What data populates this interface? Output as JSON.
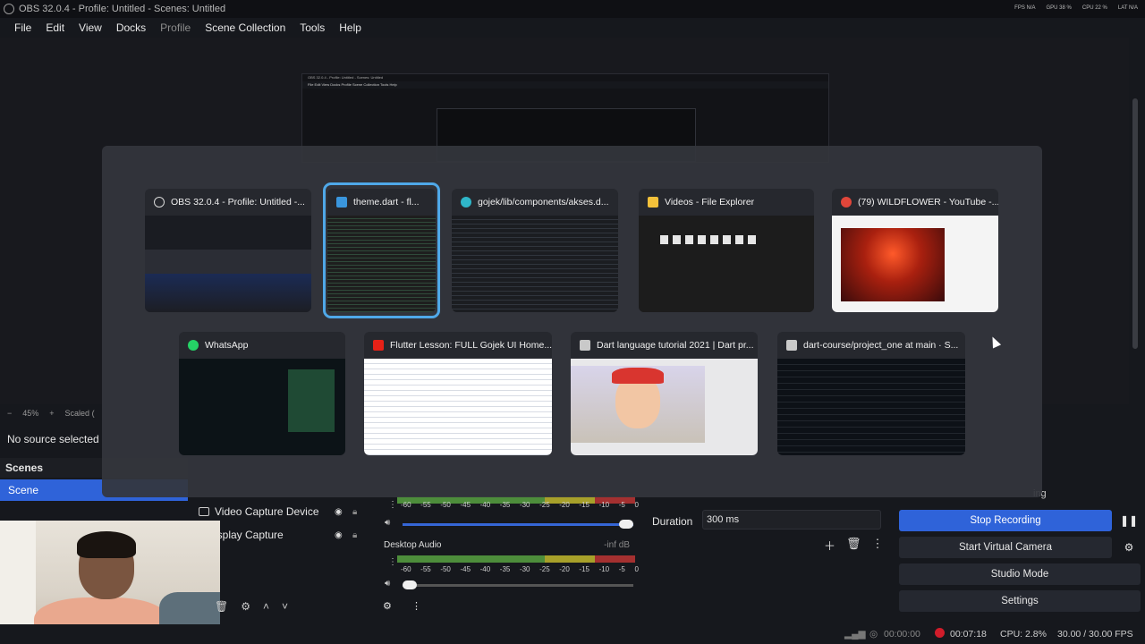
{
  "window": {
    "title": "OBS 32.0.4 - Profile: Untitled - Scenes: Untitled",
    "stats": [
      "FPS N/A",
      "GPU 38 %",
      "CPU 22 %",
      "LAT N/A"
    ]
  },
  "menu": [
    "File",
    "Edit",
    "View",
    "Docks",
    "Profile",
    "Scene Collection",
    "Tools",
    "Help"
  ],
  "preview": {
    "mini_title": "OBS 32.0.4 - Profile: Untitled - Scenes: Untitled",
    "mini_menu": "File  Edit  View  Docks  Profile  Scene Collection  Tools  Help",
    "zoom": "45%",
    "scaled_label": "Scaled ("
  },
  "no_source": "No source selected",
  "scenes": {
    "header": "Scenes",
    "items": [
      "Scene"
    ]
  },
  "sources": [
    {
      "name": "Video Capture Device"
    },
    {
      "name": "isplay Capture"
    }
  ],
  "mixer": {
    "ticks": [
      "-60",
      "-55",
      "-50",
      "-45",
      "-40",
      "-35",
      "-30",
      "-25",
      "-20",
      "-15",
      "-10",
      "-5",
      "0"
    ],
    "tracks": [
      {
        "name": "",
        "level": "",
        "volume": 1.0
      },
      {
        "name": "Desktop Audio",
        "level": "-inf dB",
        "volume": 0.0
      }
    ]
  },
  "transition": {
    "duration_label": "Duration",
    "duration_value": "300 ms"
  },
  "controls": {
    "partial": "ing",
    "stop_recording": "Stop Recording",
    "virtual_camera": "Start Virtual Camera",
    "studio_mode": "Studio Mode",
    "settings": "Settings"
  },
  "status": {
    "stream_time": "00:00:00",
    "rec_time": "00:07:18",
    "cpu": "CPU: 2.8%",
    "fps": "30.00 / 30.00 FPS"
  },
  "switcher": {
    "row1": [
      {
        "title": "OBS 32.0.4 - Profile: Untitled -...",
        "icon": "obs-icon",
        "color": "#d8d8d8"
      },
      {
        "title": "theme.dart - fl...",
        "icon": "vscode-icon",
        "color": "#3a96dd"
      },
      {
        "title": "gojek/lib/components/akses.d...",
        "icon": "edge-icon",
        "color": "#2fb6c9"
      },
      {
        "title": "Videos - File Explorer",
        "icon": "folder-icon",
        "color": "#f3c13a"
      },
      {
        "title": "(79) WILDFLOWER - YouTube -...",
        "icon": "chrome-icon",
        "color": "#e0463a"
      }
    ],
    "row2": [
      {
        "title": "WhatsApp",
        "icon": "whatsapp-icon",
        "color": "#25d366"
      },
      {
        "title": "Flutter Lesson: FULL Gojek UI Home...",
        "icon": "youtube-icon",
        "color": "#e62117"
      },
      {
        "title": "Dart language tutorial 2021 | Dart pr...",
        "icon": "window-icon",
        "color": "#c9c9c9"
      },
      {
        "title": "dart-course/project_one at main · S...",
        "icon": "window-icon",
        "color": "#c9c9c9"
      }
    ],
    "selected_index": 1
  }
}
